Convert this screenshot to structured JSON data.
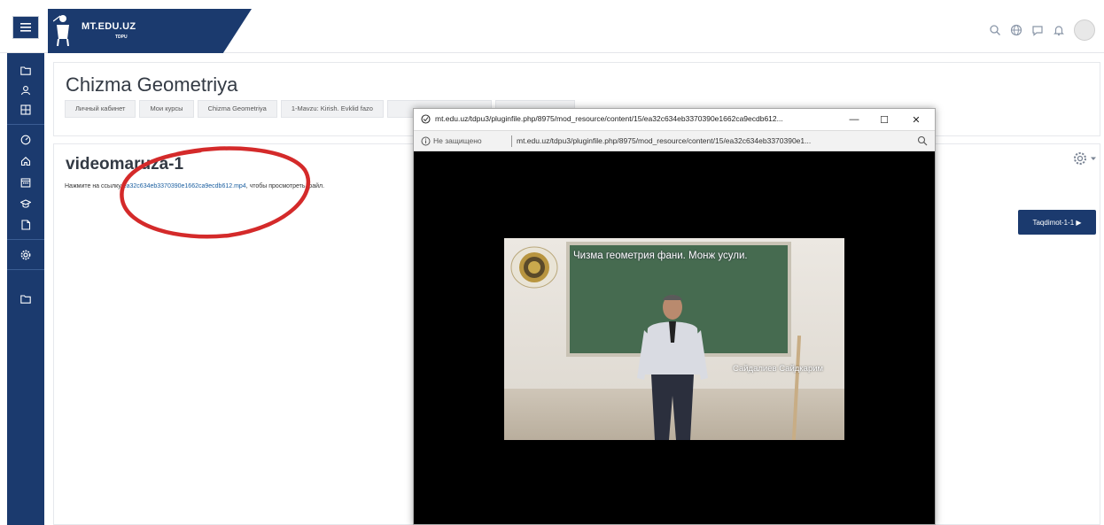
{
  "navbar": {
    "brand_title": "MT.EDU.UZ",
    "brand_subtitle": "TDPU",
    "icons": [
      "menu-icon",
      "search-icon",
      "globe-icon",
      "chat-icon",
      "bell-icon",
      "user-avatar"
    ]
  },
  "drawer": {
    "icons": [
      "folder-icon",
      "graduation-icon",
      "grid-icon",
      "dashboard-icon",
      "home-icon",
      "calendar-icon",
      "mortarboard-icon",
      "files-icon",
      "settings-icon",
      "folder-icon"
    ]
  },
  "page_header": {
    "title": "Chizma Geometriya",
    "breadcrumbs": [
      "Личный кабинет",
      "Мои курсы",
      "Chizma Geometriya",
      "1-Mavzu: Kirish. Evklid fazo",
      "",
      ""
    ]
  },
  "activity": {
    "title": "videomaruza-1",
    "note_prefix": "Нажмите на ссылку ",
    "file_link": "ea32c634eb3370390e1662ca9ecdb612.mp4",
    "note_suffix": ", чтобы просмотреть файл.",
    "next_button_label": "Taqdimot-1-1 ▶"
  },
  "popup": {
    "title": "mt.edu.uz/tdpu3/pluginfile.php/8975/mod_resource/content/15/ea32c634eb3370390e1662ca9ecdb612...",
    "minimize": "—",
    "maximize": "☐",
    "close": "✕",
    "security_label": "Не защищено",
    "url": "mt.edu.uz/tdpu3/pluginfile.php/8975/mod_resource/content/15/ea32c634eb3370390e1..."
  },
  "video": {
    "caption_top": "Чизма геометрия фани. Монж усули.",
    "caption_bottom": "Сайдалиев Сайдкарим"
  },
  "colors": {
    "brand": "#1b3a6e",
    "annotation": "#d42a2a",
    "chalkboard": "#466b50"
  }
}
